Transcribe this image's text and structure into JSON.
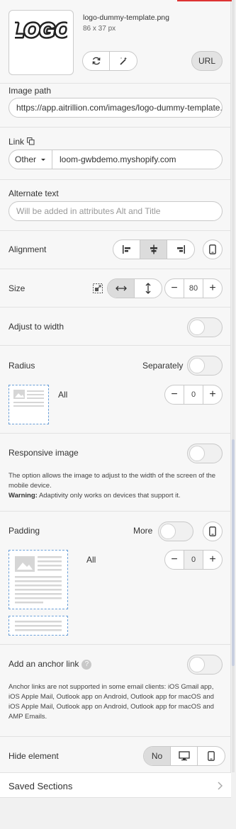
{
  "image_block": {
    "filename": "logo-dummy-template.png",
    "dimensions": "86 x 37 px",
    "url_button": "URL",
    "logo_text": "LOGO"
  },
  "image_path": {
    "label": "Image path",
    "value": "https://app.aitrillion.com/images/logo-dummy-template.png"
  },
  "link": {
    "label": "Link",
    "type_selected": "Other",
    "value": "loom-gwbdemo.myshopify.com"
  },
  "alt_text": {
    "label": "Alternate text",
    "placeholder": "Will be added in attributes Alt and Title"
  },
  "alignment": {
    "label": "Alignment"
  },
  "size": {
    "label": "Size",
    "value": "80"
  },
  "adjust_width": {
    "label": "Adjust to width"
  },
  "radius": {
    "label": "Radius",
    "separately_label": "Separately",
    "all_label": "All",
    "value": "0"
  },
  "responsive": {
    "label": "Responsive image",
    "description": "The option allows the image to adjust to the width of the screen of the mobile device.",
    "warning_label": "Warning:",
    "warning_text": "Adaptivity only works on devices that support it."
  },
  "padding": {
    "label": "Padding",
    "more_label": "More",
    "all_label": "All",
    "value": "0"
  },
  "anchor": {
    "label": "Add an anchor link",
    "help": "?",
    "description": "Anchor links are not supported in some email clients: iOS Gmail app, iOS Apple Mail, Outlook app on Android, Outlook app for macOS and iOS Apple Mail, Outlook app on Android, Outlook app for macOS and AMP Emails."
  },
  "hide": {
    "label": "Hide element",
    "no_label": "No"
  },
  "saved_sections": {
    "label": "Saved Sections"
  }
}
